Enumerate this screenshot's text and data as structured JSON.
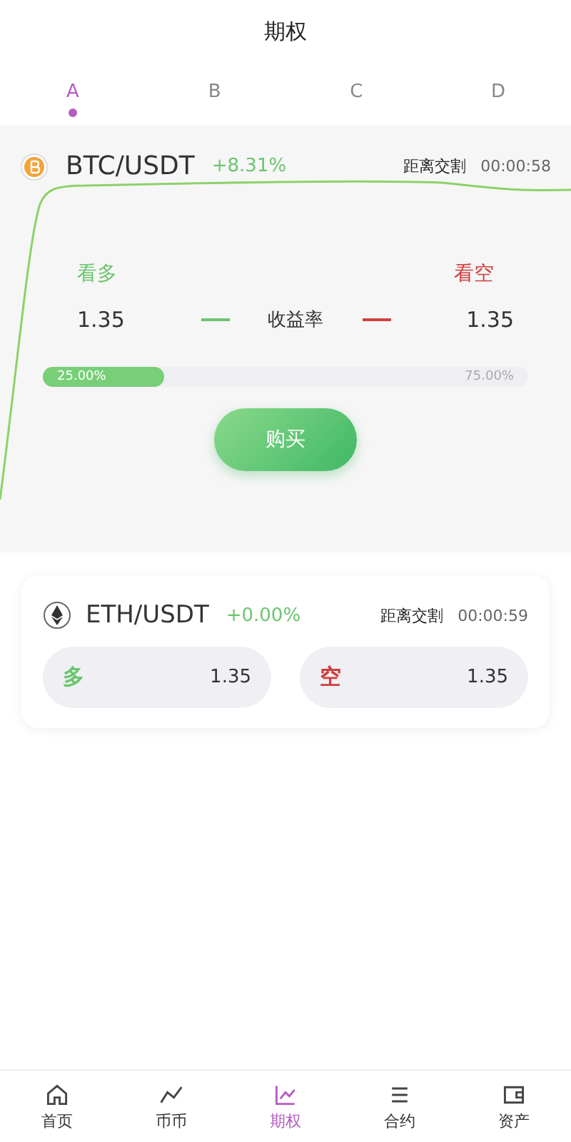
{
  "header": {
    "title": "期权"
  },
  "tabs": [
    {
      "label": "A",
      "selected": true
    },
    {
      "label": "B",
      "selected": false
    },
    {
      "label": "C",
      "selected": false
    },
    {
      "label": "D",
      "selected": false
    }
  ],
  "featured": {
    "pair": "BTC/USDT",
    "change": "+8.31%",
    "countdown_label": "距离交割",
    "countdown": "00:00:58",
    "long_label": "看多",
    "short_label": "看空",
    "long_rate": "1.35",
    "rate_label": "收益率",
    "short_rate": "1.35",
    "progress": {
      "level": 0.25,
      "left_label": "25.00%",
      "right_label": "75.00%"
    },
    "buy_button": "购买"
  },
  "cards": [
    {
      "pair": "ETH/USDT",
      "change": "+0.00%",
      "countdown_label": "距离交割",
      "countdown": "00:00:59",
      "long_label": "多",
      "long_rate": "1.35",
      "short_label": "空",
      "short_rate": "1.35"
    }
  ],
  "bottom_nav": [
    {
      "label": "首页",
      "selected": false
    },
    {
      "label": "币币",
      "selected": false
    },
    {
      "label": "期权",
      "selected": true
    },
    {
      "label": "合约",
      "selected": false
    },
    {
      "label": "资产",
      "selected": false
    }
  ]
}
